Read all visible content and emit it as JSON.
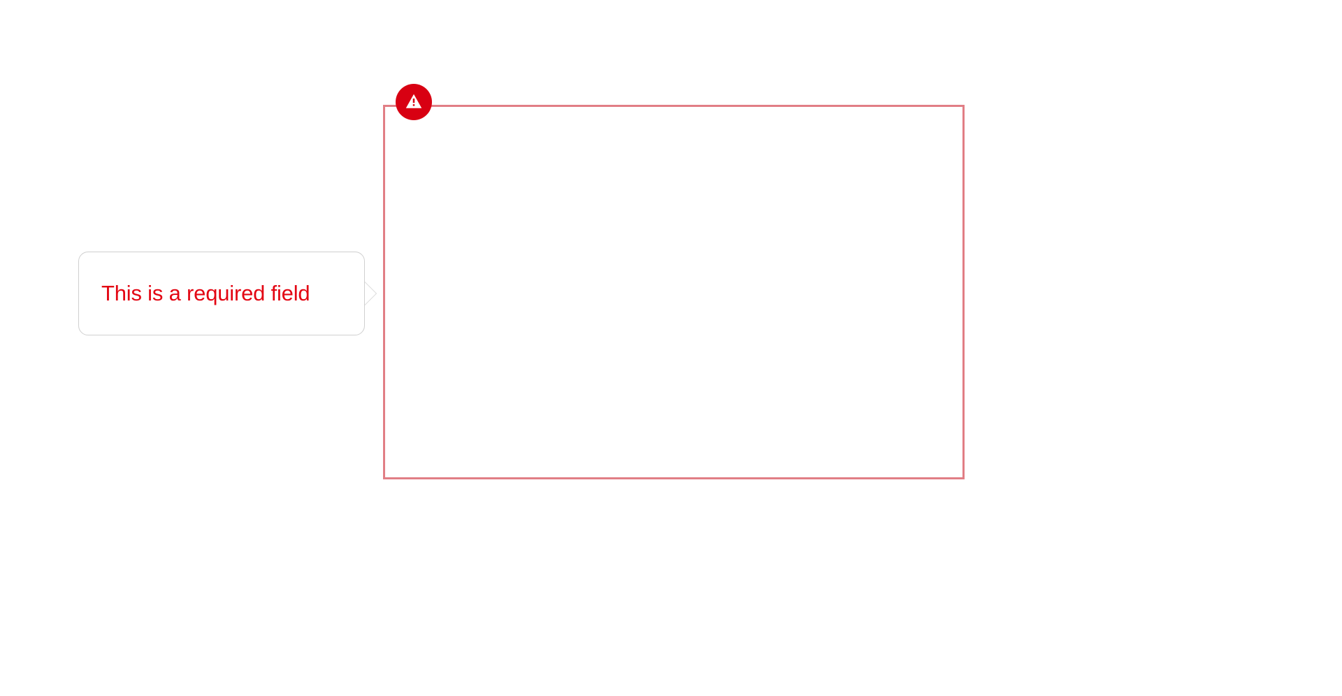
{
  "tooltip": {
    "message": "This is a required field"
  },
  "field": {
    "value": ""
  },
  "colors": {
    "error_border": "#e17e85",
    "error_badge": "#d80012",
    "error_text": "#e30613",
    "tooltip_border": "#cfcfcf"
  }
}
